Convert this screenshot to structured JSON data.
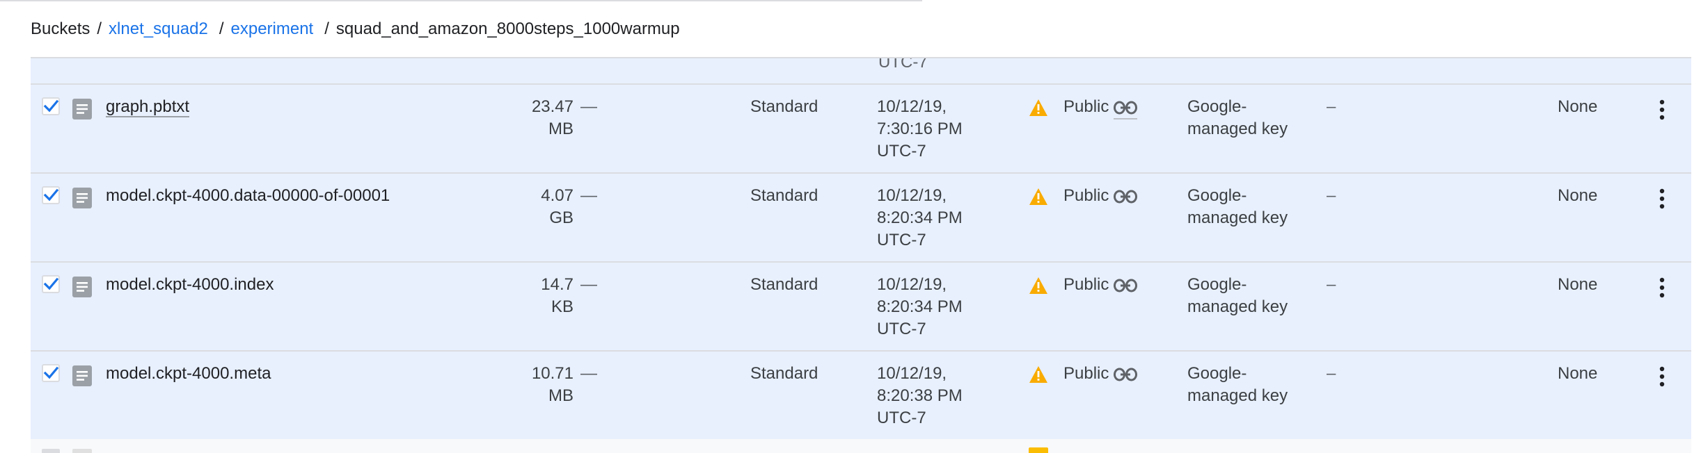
{
  "breadcrumb": {
    "root": "Buckets",
    "bucket": "xlnet_squad2",
    "folder": "experiment",
    "current": "squad_and_amazon_8000steps_1000warmup",
    "sep": "/"
  },
  "prev_row": {
    "tz": "UTC-7"
  },
  "rows": [
    {
      "name": "graph.pbtxt",
      "size_value": "23.47",
      "size_unit": "MB",
      "retention": "—",
      "storage": "Standard",
      "date": "10/12/19,",
      "time": "7:30:16 PM",
      "tz": "UTC-7",
      "access": "Public",
      "encryption_1": "Google-",
      "encryption_2": "managed key",
      "hold": "–",
      "lifecycle": "None",
      "checked": true
    },
    {
      "name": "model.ckpt-4000.data-00000-of-00001",
      "size_value": "4.07",
      "size_unit": "GB",
      "retention": "—",
      "storage": "Standard",
      "date": "10/12/19,",
      "time": "8:20:34 PM",
      "tz": "UTC-7",
      "access": "Public",
      "encryption_1": "Google-",
      "encryption_2": "managed key",
      "hold": "–",
      "lifecycle": "None",
      "checked": true
    },
    {
      "name": "model.ckpt-4000.index",
      "size_value": "14.7",
      "size_unit": "KB",
      "retention": "—",
      "storage": "Standard",
      "date": "10/12/19,",
      "time": "8:20:34 PM",
      "tz": "UTC-7",
      "access": "Public",
      "encryption_1": "Google-",
      "encryption_2": "managed key",
      "hold": "–",
      "lifecycle": "None",
      "checked": true
    },
    {
      "name": "model.ckpt-4000.meta",
      "size_value": "10.71",
      "size_unit": "MB",
      "retention": "—",
      "storage": "Standard",
      "date": "10/12/19,",
      "time": "8:20:38 PM",
      "tz": "UTC-7",
      "access": "Public",
      "encryption_1": "Google-",
      "encryption_2": "managed key",
      "hold": "–",
      "lifecycle": "None",
      "checked": true
    }
  ],
  "icons": {
    "checkbox": "checkbox-checked-icon",
    "file": "file-icon",
    "warning": "warning-icon",
    "link": "link-icon",
    "more": "more-vert-icon"
  },
  "colors": {
    "accent": "#1a73e8",
    "row_selected": "#e8f0fe",
    "warning": "#f9ab00",
    "divider": "#dadce0"
  }
}
